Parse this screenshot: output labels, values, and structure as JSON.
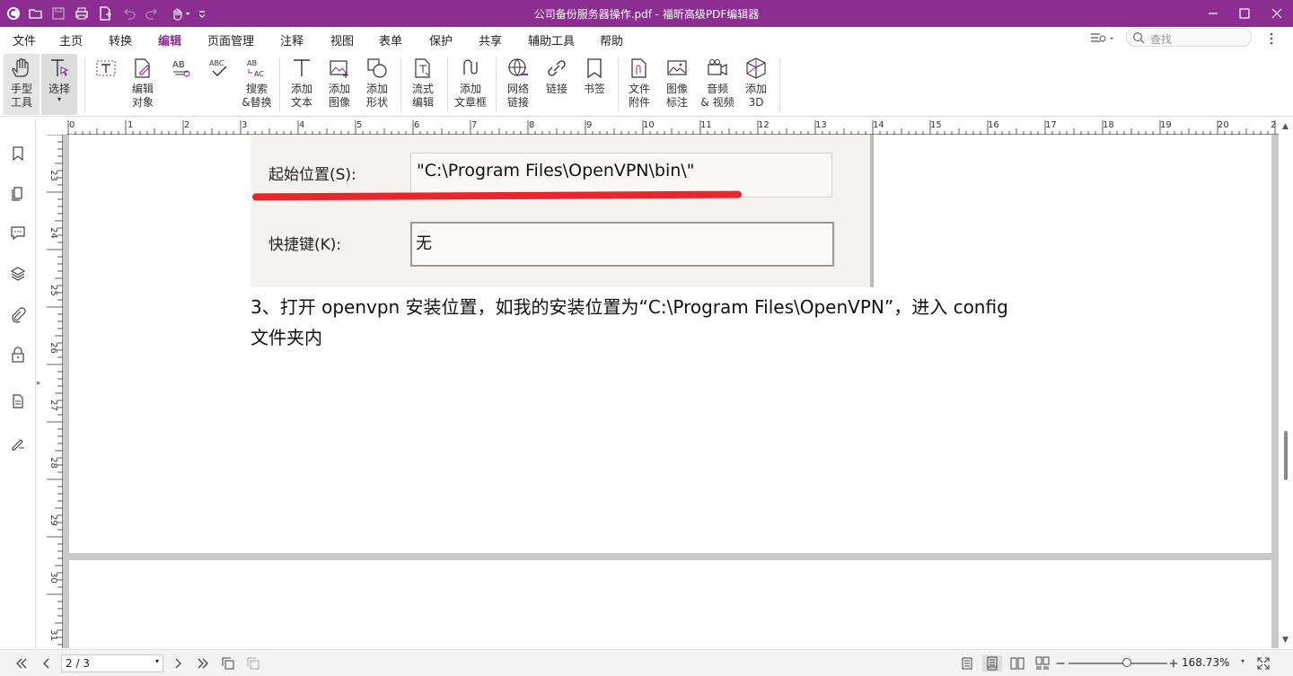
{
  "window": {
    "title": "公司备份服务器操作.pdf - 福昕高级PDF编辑器"
  },
  "menu": [
    "文件",
    "主页",
    "转换",
    "编辑",
    "页面管理",
    "注释",
    "视图",
    "表单",
    "保护",
    "共享",
    "辅助工具",
    "帮助"
  ],
  "active_menu": "编辑",
  "search": {
    "placeholder": "查找"
  },
  "ribbon": {
    "hand": "手型\n工具",
    "select": "选择",
    "edit_object": "编辑\n对象",
    "search_replace": "搜索\n&替换",
    "add_text": "添加\n文本",
    "add_image": "添加\n图像",
    "add_shape": "添加\n形状",
    "flow_edit": "流式\n编辑",
    "add_article": "添加\n文章框",
    "web_link": "网络\n链接",
    "link": "链接",
    "bookmark": "书签",
    "file_attach": "文件\n附件",
    "image_annot": "图像\n标注",
    "audio_video": "音频\n& 视频",
    "add_3d": "添加\n3D"
  },
  "hruler_labels": [
    "0",
    "1",
    "2",
    "3",
    "4",
    "5",
    "6",
    "7",
    "8",
    "9",
    "10",
    "11",
    "12",
    "13",
    "14",
    "15",
    "16",
    "17",
    "18",
    "19",
    "20",
    "2"
  ],
  "vruler_labels": [
    "23",
    "24",
    "25",
    "26",
    "27",
    "28",
    "29",
    "30",
    "31"
  ],
  "document": {
    "screenshot": {
      "label1": "起始位置(S):",
      "value1": "\"C:\\Program Files\\OpenVPN\\bin\\\"",
      "label2": "快捷键(K):",
      "value2": "无"
    },
    "line1": "3、打开 openvpn 安装位置，如我的安装位置为“C:\\Program Files\\OpenVPN”，进入 config",
    "line2": "文件夹内"
  },
  "status": {
    "page": "2 / 3",
    "zoom": "168.73%"
  },
  "colors": {
    "brand": "#8b2d91",
    "annotation_red": "#e8262b"
  }
}
